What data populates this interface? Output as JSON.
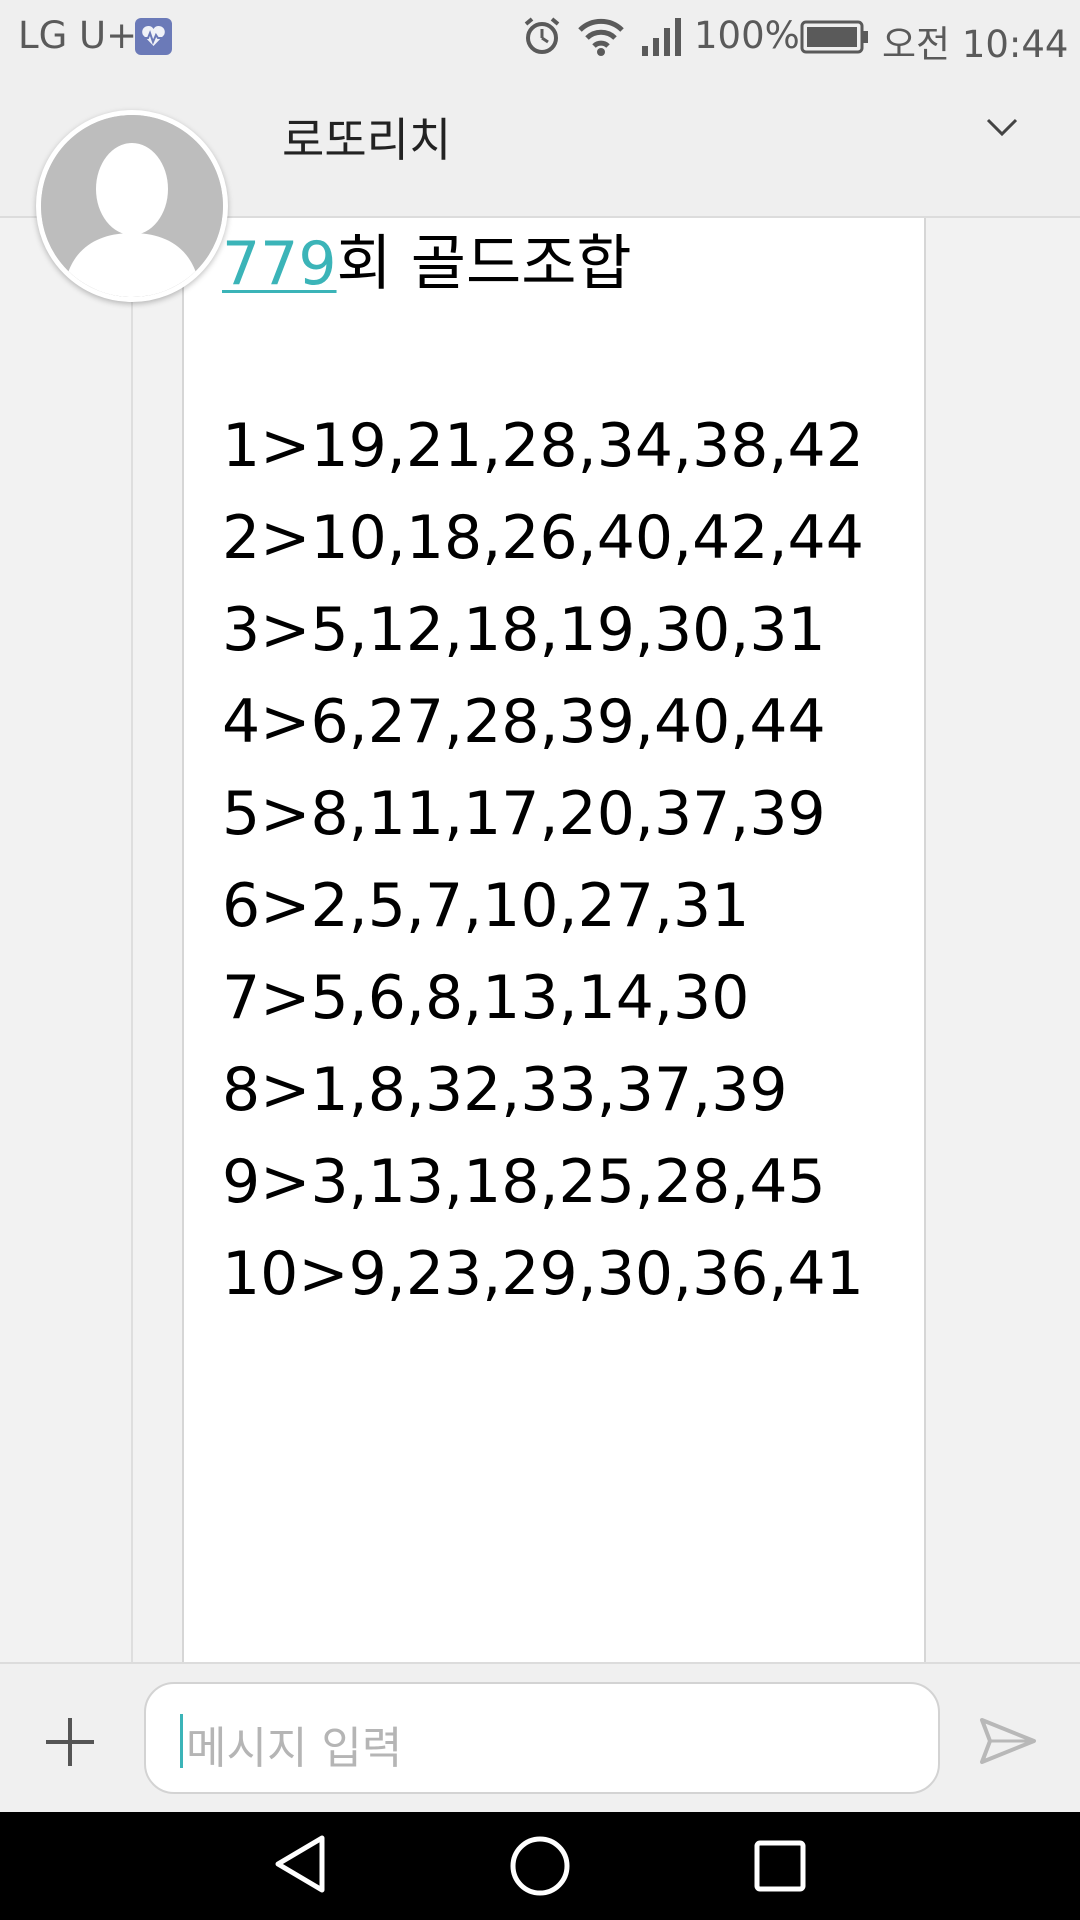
{
  "status_bar": {
    "carrier": "LG U+",
    "battery_percent": "100%",
    "time": "오전 10:44",
    "icons": [
      "health-app-icon",
      "alarm-icon",
      "wifi-icon",
      "signal-icon",
      "battery-icon"
    ]
  },
  "header": {
    "contact_name": "로또리치",
    "expand_icon": "chevron-down-icon"
  },
  "message": {
    "round_number": "779",
    "round_suffix": "회 골드조합",
    "combos_group1": [
      "1>19,21,28,34,38,42",
      "2>10,18,26,40,42,44",
      "3>5,12,18,19,30,31",
      "4>6,27,28,39,40,44",
      "5>8,11,17,20,37,39"
    ],
    "combos_group2": [
      "6>2,5,7,10,27,31",
      "7>5,6,8,13,14,30",
      "8>1,8,32,33,37,39",
      "9>3,13,18,25,28,45",
      "10>9,23,29,30,36,41"
    ]
  },
  "compose": {
    "placeholder": "메시지 입력"
  },
  "colors": {
    "link": "#3bb4b8",
    "background": "#f2f2f2",
    "bubble": "#ffffff",
    "navbar": "#000000"
  }
}
